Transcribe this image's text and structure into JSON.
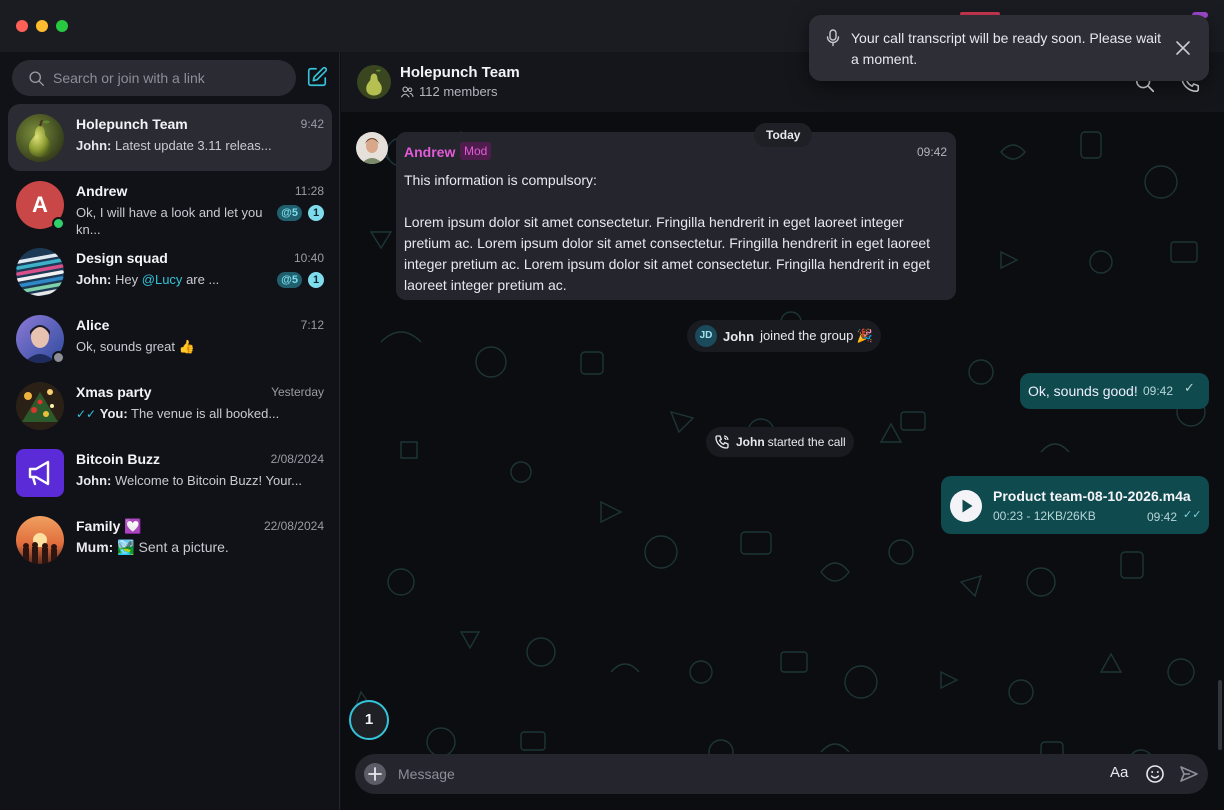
{
  "search": {
    "placeholder": "Search or join with a link"
  },
  "chats": [
    {
      "name": "Holepunch Team",
      "time": "9:42",
      "sender": "John:",
      "preview": "Latest update 3.11 releas..."
    },
    {
      "name": "Andrew",
      "time": "11:28",
      "initial": "A",
      "preview": "Ok, I will have a look and let you kn...",
      "mentions": "@5",
      "unread": "1"
    },
    {
      "name": "Design squad",
      "time": "10:40",
      "sender": "John:",
      "preview_pre": "Hey",
      "preview_mention": "@Lucy",
      "preview_post": "are ...",
      "mentions": "@5",
      "unread": "1"
    },
    {
      "name": "Alice",
      "time": "7:12",
      "preview": "Ok, sounds great 👍"
    },
    {
      "name": "Xmas party",
      "time": "Yesterday",
      "sender": "You:",
      "preview": "The venue is all booked..."
    },
    {
      "name": "Bitcoin Buzz",
      "time": "2/08/2024",
      "sender": "John:",
      "preview": "Welcome to Bitcoin Buzz! Your..."
    },
    {
      "name": "Family 💟",
      "time": "22/08/2024",
      "sender": "Mum:",
      "preview": "🏞️ Sent a picture."
    }
  ],
  "header": {
    "title": "Holepunch Team",
    "members": "112 members"
  },
  "conversation": {
    "day": "Today",
    "message": {
      "sender": "Andrew",
      "role": "Mod",
      "time": "09:42",
      "text": "This information is compulsory:\n\nLorem ipsum dolor sit amet consectetur. Fringilla hendrerit in eget laoreet integer pretium ac. Lorem ipsum dolor sit amet consectetur. Fringilla hendrerit in eget laoreet integer pretium ac. Lorem ipsum dolor sit amet consectetur. Fringilla hendrerit in eget laoreet integer pretium ac."
    },
    "joined": {
      "initials": "JD",
      "name": "John",
      "text": "joined the group 🎉"
    },
    "outgoing": {
      "text": "Ok, sounds good!",
      "time": "09:42"
    },
    "call": {
      "name": "John",
      "text": "started the call"
    },
    "audio": {
      "title": "Product team-08-10-2026.m4a",
      "meta": "00:23 - 12KB/26KB",
      "time": "09:42"
    },
    "unread_count": "1"
  },
  "composer": {
    "placeholder": "Message",
    "format_label": "Aa"
  },
  "toast": {
    "text": "Your call transcript will be ready soon. Please wait a moment."
  },
  "colors": {
    "accent": "#34c3d9",
    "mod": "#e35bd8",
    "outgoing": "#0f4a4e",
    "online": "#2fd16b"
  }
}
